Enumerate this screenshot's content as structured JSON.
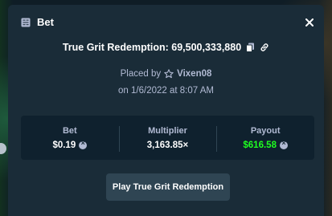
{
  "header": {
    "title": "Bet",
    "icon": "bet-slip-icon",
    "close_icon": "close-icon"
  },
  "game": {
    "title": "True Grit Redemption: 69,500,333,880",
    "copy_icon": "copy-icon",
    "link_icon": "link-icon"
  },
  "placed": {
    "prefix": "Placed by",
    "user_icon": "star-outline-icon",
    "username": "Vixen08",
    "date_text": "on 1/6/2022 at 8:07 AM"
  },
  "stats": {
    "bet_label": "Bet",
    "bet_value": "$0.19",
    "multiplier_label": "Multiplier",
    "multiplier_value": "3,163.85×",
    "payout_label": "Payout",
    "payout_value": "$616.58",
    "currency_icon": "currency-coin-icon"
  },
  "actions": {
    "play_label": "Play True Grit Redemption"
  },
  "colors": {
    "modal_bg": "#1a2c38",
    "panel_bg": "#0f212e",
    "muted_text": "#b1bad3",
    "payout_green": "#1fff20",
    "button_bg": "#2f4553"
  }
}
